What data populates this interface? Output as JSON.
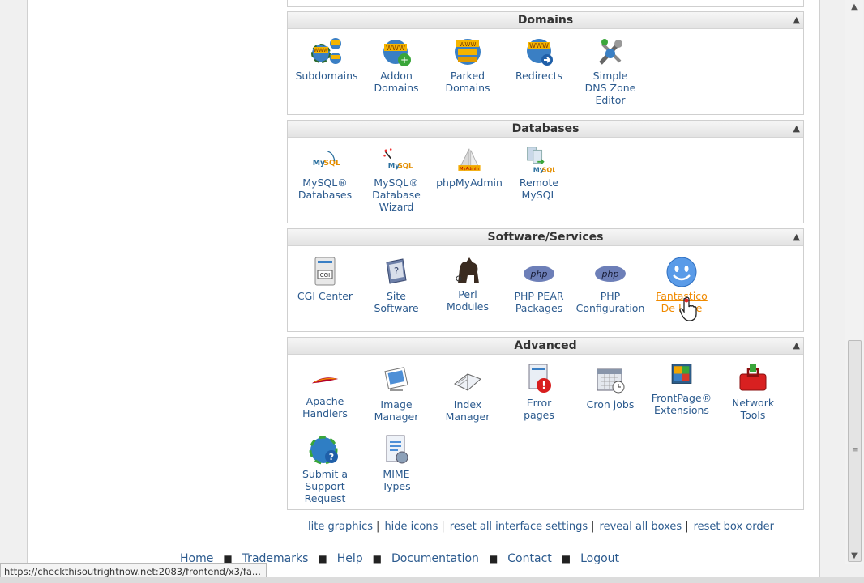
{
  "sections": {
    "domains": {
      "title": "Domains",
      "items": [
        {
          "label": "Subdomains",
          "icon": "subdomains-icon"
        },
        {
          "label": "Addon\nDomains",
          "icon": "addon-domains-icon"
        },
        {
          "label": "Parked\nDomains",
          "icon": "parked-domains-icon"
        },
        {
          "label": "Redirects",
          "icon": "redirects-icon"
        },
        {
          "label": "Simple\nDNS Zone\nEditor",
          "icon": "dns-zone-editor-icon"
        }
      ]
    },
    "databases": {
      "title": "Databases",
      "items": [
        {
          "label": "MySQL®\nDatabases",
          "icon": "mysql-databases-icon"
        },
        {
          "label": "MySQL®\nDatabase\nWizard",
          "icon": "mysql-wizard-icon"
        },
        {
          "label": "phpMyAdmin",
          "icon": "phpmyadmin-icon"
        },
        {
          "label": "Remote\nMySQL",
          "icon": "remote-mysql-icon"
        }
      ]
    },
    "software": {
      "title": "Software/Services",
      "items": [
        {
          "label": "CGI Center",
          "icon": "cgi-center-icon"
        },
        {
          "label": "Site\nSoftware",
          "icon": "site-software-icon"
        },
        {
          "label": "Perl\nModules",
          "icon": "perl-modules-icon"
        },
        {
          "label": "PHP PEAR\nPackages",
          "icon": "php-pear-icon"
        },
        {
          "label": "PHP\nConfiguration",
          "icon": "php-configuration-icon"
        },
        {
          "label": "Fantastico\nDe Luxe",
          "icon": "fantastico-icon"
        }
      ]
    },
    "advanced": {
      "title": "Advanced",
      "items": [
        {
          "label": "Apache\nHandlers",
          "icon": "apache-handlers-icon"
        },
        {
          "label": "Image\nManager",
          "icon": "image-manager-icon"
        },
        {
          "label": "Index\nManager",
          "icon": "index-manager-icon"
        },
        {
          "label": "Error\npages",
          "icon": "error-pages-icon"
        },
        {
          "label": "Cron jobs",
          "icon": "cron-jobs-icon"
        },
        {
          "label": "FrontPage®\nExtensions",
          "icon": "frontpage-extensions-icon"
        },
        {
          "label": "Network\nTools",
          "icon": "network-tools-icon"
        },
        {
          "label": "Submit a\nSupport\nRequest",
          "icon": "support-request-icon"
        },
        {
          "label": "MIME\nTypes",
          "icon": "mime-types-icon"
        }
      ]
    }
  },
  "footer_links": {
    "lite_graphics": "lite graphics",
    "hide_icons": "hide icons",
    "reset_settings": "reset all interface settings",
    "reveal_boxes": "reveal all boxes",
    "reset_order": "reset box order",
    "separator": "|"
  },
  "bottom_nav": {
    "home": "Home",
    "trademarks": "Trademarks",
    "help": "Help",
    "documentation": "Documentation",
    "contact": "Contact",
    "logout": "Logout"
  },
  "status_url": "https://checkthisoutrightnow.net:2083/frontend/x3/fa...",
  "colors": {
    "link": "#2b5a8e",
    "hover_link": "#f08a00",
    "header_bg": "#e6e6e6"
  }
}
